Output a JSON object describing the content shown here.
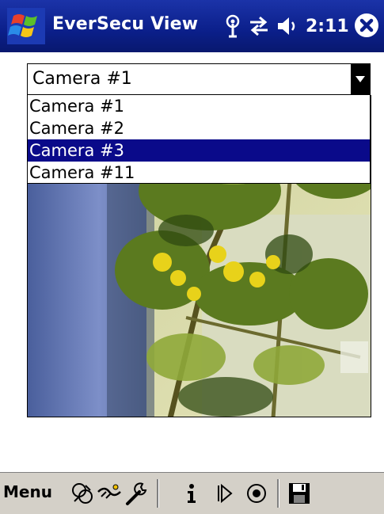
{
  "titlebar": {
    "app_title": "EverSecu View",
    "time": "2:11",
    "start_icon": "windows-flag-icon",
    "status_icons": [
      "antenna-icon",
      "connectivity-arrows-icon",
      "speaker-icon"
    ],
    "close_icon": "close-icon"
  },
  "camera_select": {
    "value": "Camera #1",
    "options": [
      "Camera #1",
      "Camera #2",
      "Camera #3",
      "Camera #11"
    ],
    "highlighted": "Camera #3"
  },
  "toolbar": {
    "menu_label": "Menu",
    "icons": [
      "network-icon",
      "handshake-icon",
      "wrench-icon",
      "info-icon",
      "play-icon",
      "record-icon",
      "save-icon"
    ]
  },
  "colors": {
    "titlebar": "#0b1f8a",
    "selection": "#0a0a8a",
    "toolbar": "#d4d0c8"
  }
}
